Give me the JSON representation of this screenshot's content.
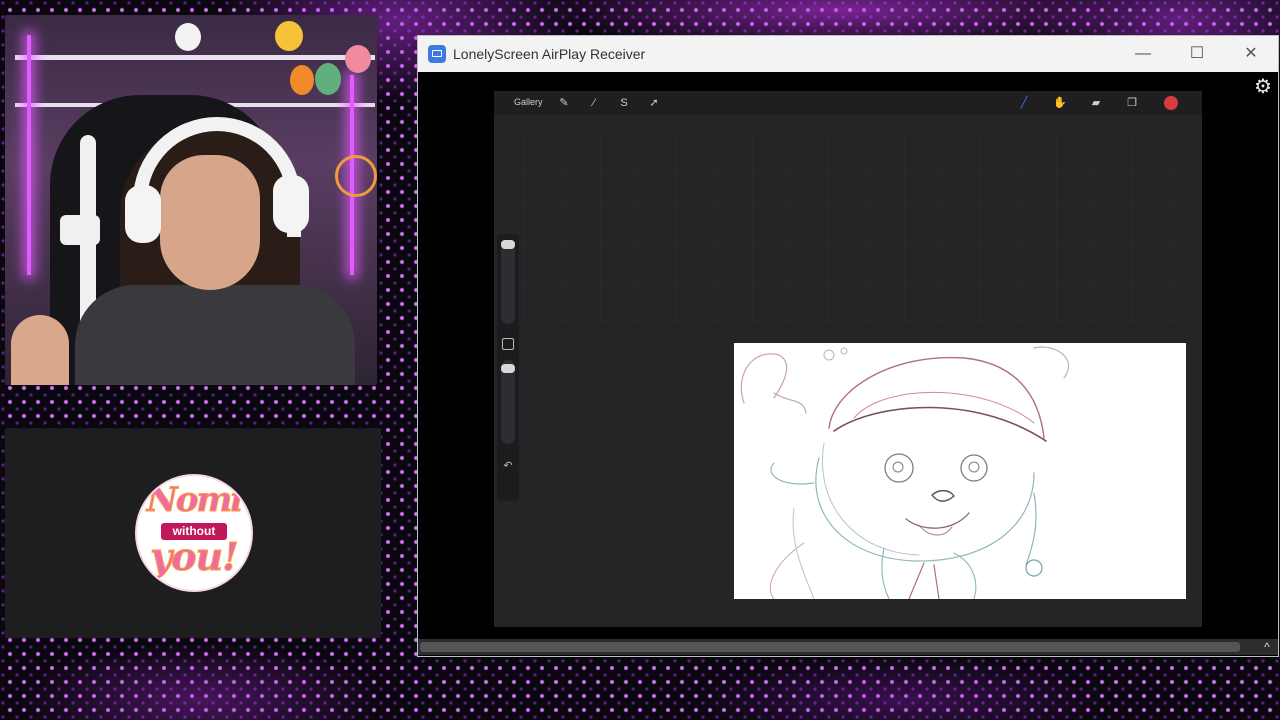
{
  "window": {
    "title": "LonelyScreen AirPlay Receiver",
    "minimize_glyph": "—",
    "maximize_glyph": "☐",
    "close_glyph": "✕",
    "settings_icon": "gear-icon",
    "scroll_up_glyph": "^"
  },
  "procreate": {
    "gallery_label": "Gallery",
    "tools": [
      "wrench-icon",
      "magic-wand-icon",
      "selection-icon",
      "transform-icon"
    ],
    "right_tools": [
      "brush-icon",
      "smudge-icon",
      "eraser-icon",
      "layers-icon"
    ],
    "color": "#d93b3b",
    "undo_glyph": "↶"
  },
  "logo": {
    "line1": "Nomi",
    "line2": "without",
    "line3": "you!"
  },
  "colors": {
    "neon_accent": "#e15cff",
    "background": "#0b0710"
  }
}
